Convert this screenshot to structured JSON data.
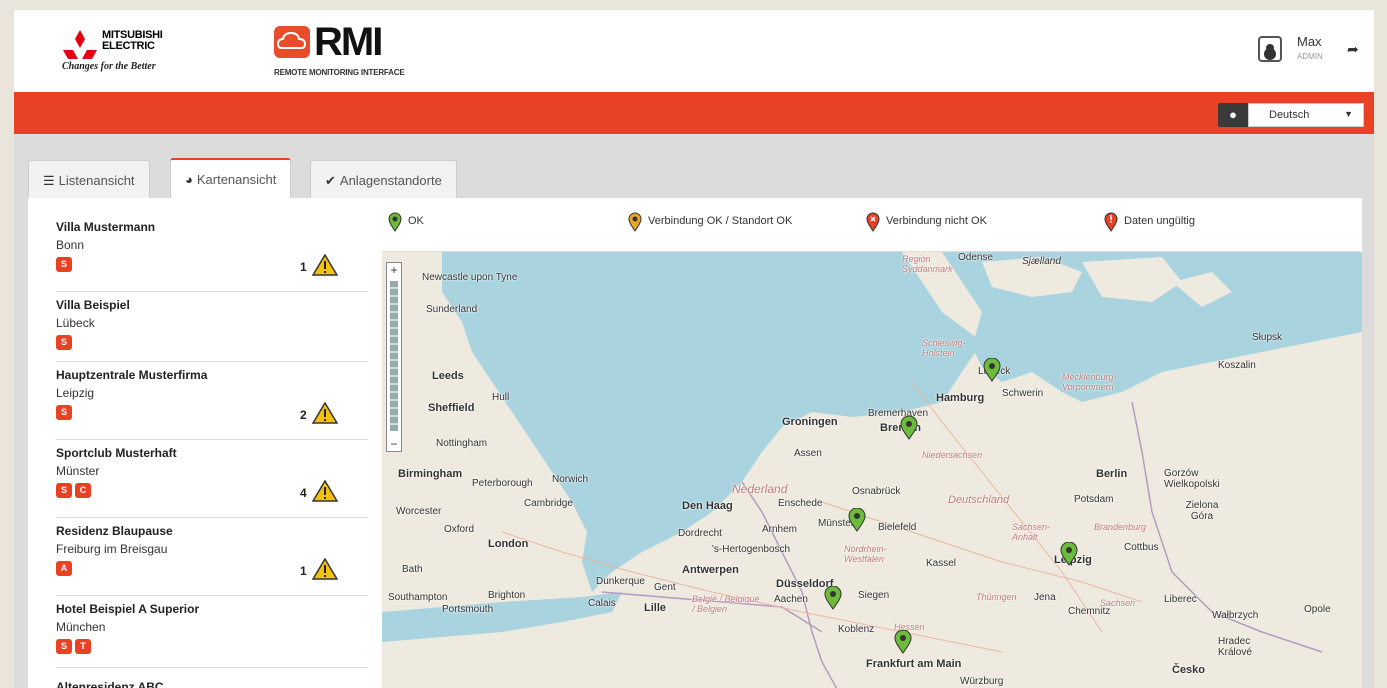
{
  "header": {
    "brand_name_line1": "MITSUBISHI",
    "brand_name_line2": "ELECTRIC",
    "brand_slogan": "Changes for the Better",
    "app_logo_text": "RMI",
    "app_logo_subtitle": "REMOTE MONITORING INTERFACE",
    "user_name": "Max",
    "user_role": "ADMIN"
  },
  "language": {
    "selected": "Deutsch"
  },
  "tabs": [
    {
      "label": "Listenansicht",
      "icon": "list-icon"
    },
    {
      "label": "Kartenansicht",
      "icon": "globe-icon"
    },
    {
      "label": "Anlagenstandorte",
      "icon": "check-icon"
    }
  ],
  "active_tab": "Kartenansicht",
  "sites": [
    {
      "name": "Villa Mustermann",
      "city": "Bonn",
      "badges": [
        "S"
      ],
      "alerts": "1"
    },
    {
      "name": "Villa Beispiel",
      "city": "Lübeck",
      "badges": [
        "S"
      ],
      "alerts": ""
    },
    {
      "name": "Hauptzentrale Musterfirma",
      "city": "Leipzig",
      "badges": [
        "S"
      ],
      "alerts": "2"
    },
    {
      "name": "Sportclub Musterhaft",
      "city": "Münster",
      "badges": [
        "S",
        "C"
      ],
      "alerts": "4"
    },
    {
      "name": "Residenz Blaupause",
      "city": "Freiburg im Breisgau",
      "badges": [
        "A"
      ],
      "alerts": "1"
    },
    {
      "name": "Hotel Beispiel A Superior",
      "city": "München",
      "badges": [
        "S",
        "T"
      ],
      "alerts": ""
    },
    {
      "name": "Altenresidenz ABC",
      "city": "",
      "badges": [],
      "alerts": ""
    }
  ],
  "legend": [
    {
      "label": "OK",
      "color": "#6dbb3a"
    },
    {
      "label": "Verbindung OK / Standort OK",
      "color": "#e8a826"
    },
    {
      "label": "Verbindung nicht OK",
      "color": "#e84124"
    },
    {
      "label": "Daten ungültig",
      "color": "#e84124"
    }
  ],
  "map_labels": [
    "Newcastle upon Tyne",
    "Sunderland",
    "Leeds",
    "Sheffield",
    "Hull",
    "Nottingham",
    "Birmingham",
    "Peterborough",
    "Norwich",
    "Cambridge",
    "Worcester",
    "Oxford",
    "London",
    "Bath",
    "Southampton",
    "Brighton",
    "Portsmouth",
    "Calais",
    "Lille",
    "Dunkerque",
    "Gent",
    "België / Belgique / Belgien",
    "Antwerpen",
    "Den Haag",
    "Dordrecht",
    "Arnhem",
    "'s-Hertogenbosch",
    "Nederland",
    "Groningen",
    "Assen",
    "Enschede",
    "Münster",
    "Osnabrück",
    "Bielefeld",
    "Düsseldorf",
    "Aachen",
    "Siegen",
    "Koblenz",
    "Frankfurt am Main",
    "Bremerhaven",
    "Bremen",
    "Hamburg",
    "Lübeck",
    "Schwerin",
    "Kassel",
    "Deutschland",
    "Berlin",
    "Potsdam",
    "Leipzig",
    "Jena",
    "Chemnitz",
    "Cottbus",
    "Liberec",
    "Česko",
    "Odense",
    "Sjælland",
    "Słupsk",
    "Koszalin",
    "Gorzów Wielkopolski",
    "Zielona Góra",
    "Wałbrzych",
    "Hradec Králové",
    "Opole",
    "Würzburg",
    "Mecklenburg-Vorpommern",
    "Niedersachsen",
    "Schleswig-Holstein",
    "Nordrhein-Westfalen",
    "Hessen",
    "Thüringen",
    "Sachsen",
    "Brandenburg",
    "Sachsen-Anhalt",
    "Region Syddanmark"
  ]
}
